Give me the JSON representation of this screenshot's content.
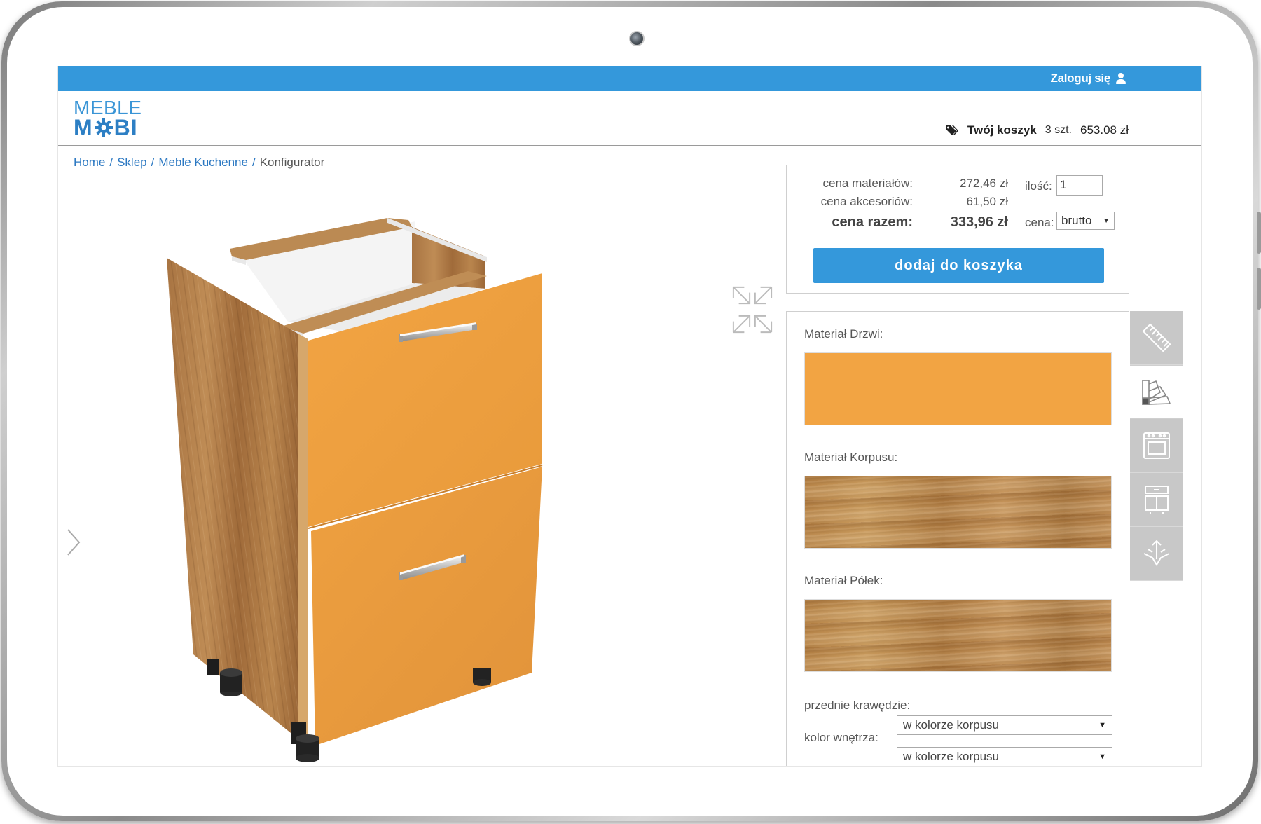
{
  "topbar": {
    "login_label": "Zaloguj się"
  },
  "header": {
    "logo_line1": "MEBLE",
    "logo_line2_a": "M",
    "logo_line2_b": "BI",
    "cart_label": "Twój koszyk",
    "cart_qty": "3 szt.",
    "cart_total": "653.08 zł"
  },
  "breadcrumb": {
    "items": [
      "Home",
      "Sklep",
      "Meble Kuchenne"
    ],
    "current": "Konfigurator",
    "separator": "/"
  },
  "price": {
    "materials_label": "cena materiałów:",
    "materials_value": "272,46 zł",
    "accessories_label": "cena akcesoriów:",
    "accessories_value": "61,50 zł",
    "total_label": "cena razem:",
    "total_value": "333,96 zł",
    "qty_label": "ilość:",
    "qty_value": "1",
    "price_type_label": "cena:",
    "price_type_value": "brutto",
    "add_to_cart": "dodaj do koszyka"
  },
  "materials": {
    "door_label": "Materiał Drzwi:",
    "body_label": "Materiał Korpusu:",
    "shelves_label": "Materiał Półek:",
    "front_edges_label": "przednie krawędzie:",
    "interior_color_label": "kolor wnętrza:",
    "front_edges_value": "w kolorze korpusu",
    "interior_color_value": "w kolorze korpusu",
    "door_color": "#f2a443"
  },
  "tabs": [
    "ruler-icon",
    "color-palette-icon",
    "oven-icon",
    "cabinet-layout-icon",
    "assembly-icon"
  ],
  "colors": {
    "accent": "#3498db",
    "link": "#2b78c2"
  }
}
